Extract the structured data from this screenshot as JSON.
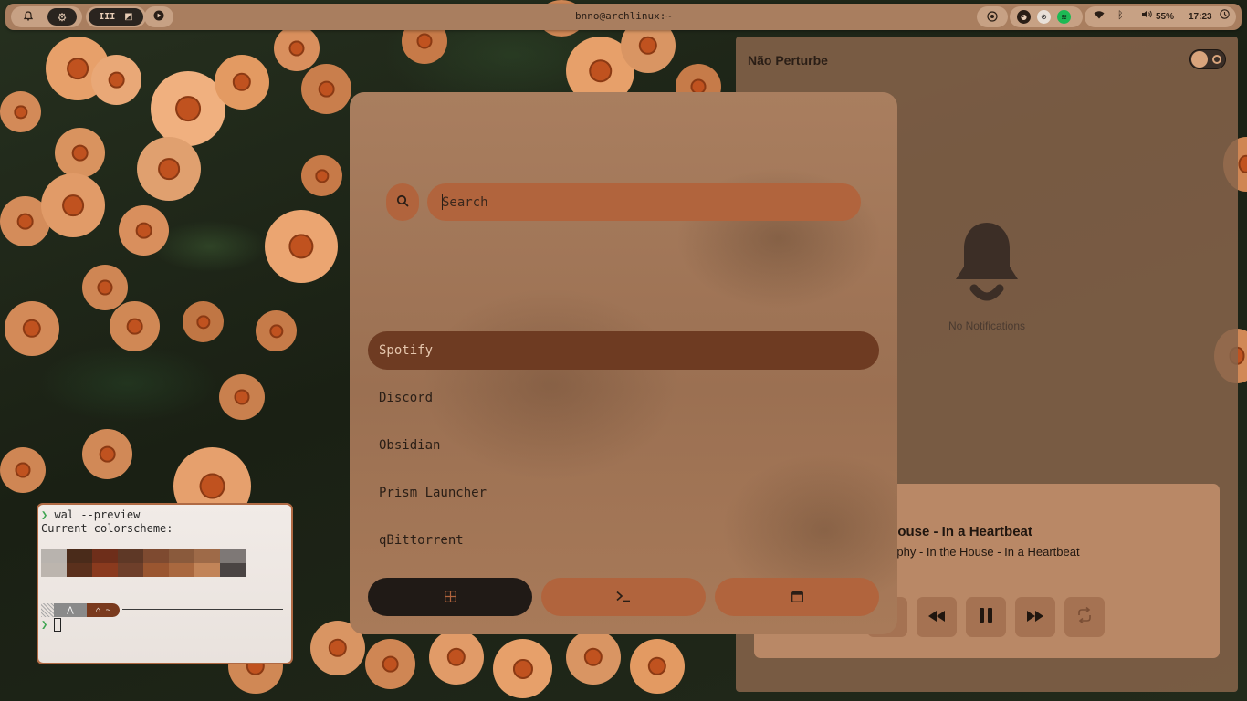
{
  "colors": {
    "accent": "#b1643d",
    "selected_item": "#6e3b22",
    "bar": "#a97e5f",
    "panel": "#87644b",
    "terminal_border": "#b06a44"
  },
  "topbar": {
    "left_icons": [
      "bell-icon",
      "gear-icon"
    ],
    "workspace_label": "III",
    "workspace_icon": "app-icon",
    "media_icon": "play-icon",
    "window_title": "bnno@archlinux:~",
    "tray_icons": [
      "record-icon",
      "discord-icon",
      "steam-icon",
      "spotify-icon"
    ],
    "status_icons": [
      "wifi-icon",
      "bluetooth-icon",
      "volume-icon",
      "clock-icon"
    ],
    "volume": "55%",
    "time": "17:23"
  },
  "launcher": {
    "search": {
      "placeholder": "Search",
      "value": ""
    },
    "apps": [
      {
        "label": "Spotify",
        "selected": true
      },
      {
        "label": "Discord",
        "selected": false
      },
      {
        "label": "Obsidian",
        "selected": false
      },
      {
        "label": "Prism Launcher",
        "selected": false
      },
      {
        "label": "qBittorrent",
        "selected": false
      }
    ],
    "modes": [
      "apps-grid-icon",
      "terminal-icon",
      "window-icon"
    ]
  },
  "notifications": {
    "title": "Não Perturbe",
    "dnd_enabled": false,
    "empty_text": "No Notifications",
    "media": {
      "title": "e House - In a Heartbeat",
      "artist": "Murphy - In the House - In a Heartbeat",
      "controls": [
        "shuffle-icon",
        "previous-icon",
        "pause-icon",
        "next-icon",
        "repeat-icon"
      ]
    }
  },
  "terminal": {
    "prompt_symbol": "❯",
    "command": " wal --preview",
    "output": "Current colorscheme:",
    "palette_row1": [
      "#b8b3ae",
      "#4a2b1a",
      "#6e2e1a",
      "#5e3826",
      "#7e4a30",
      "#8a5a3c",
      "#9e6a48",
      "#7e7876"
    ],
    "palette_row2": [
      "#bcb5ae",
      "#5a301c",
      "#8a3a1e",
      "#6e3f2a",
      "#9a5630",
      "#a9683f",
      "#c28458",
      "#4a4443"
    ],
    "powerline_home": "⌂ ~",
    "powerline_arch": "⋀"
  }
}
